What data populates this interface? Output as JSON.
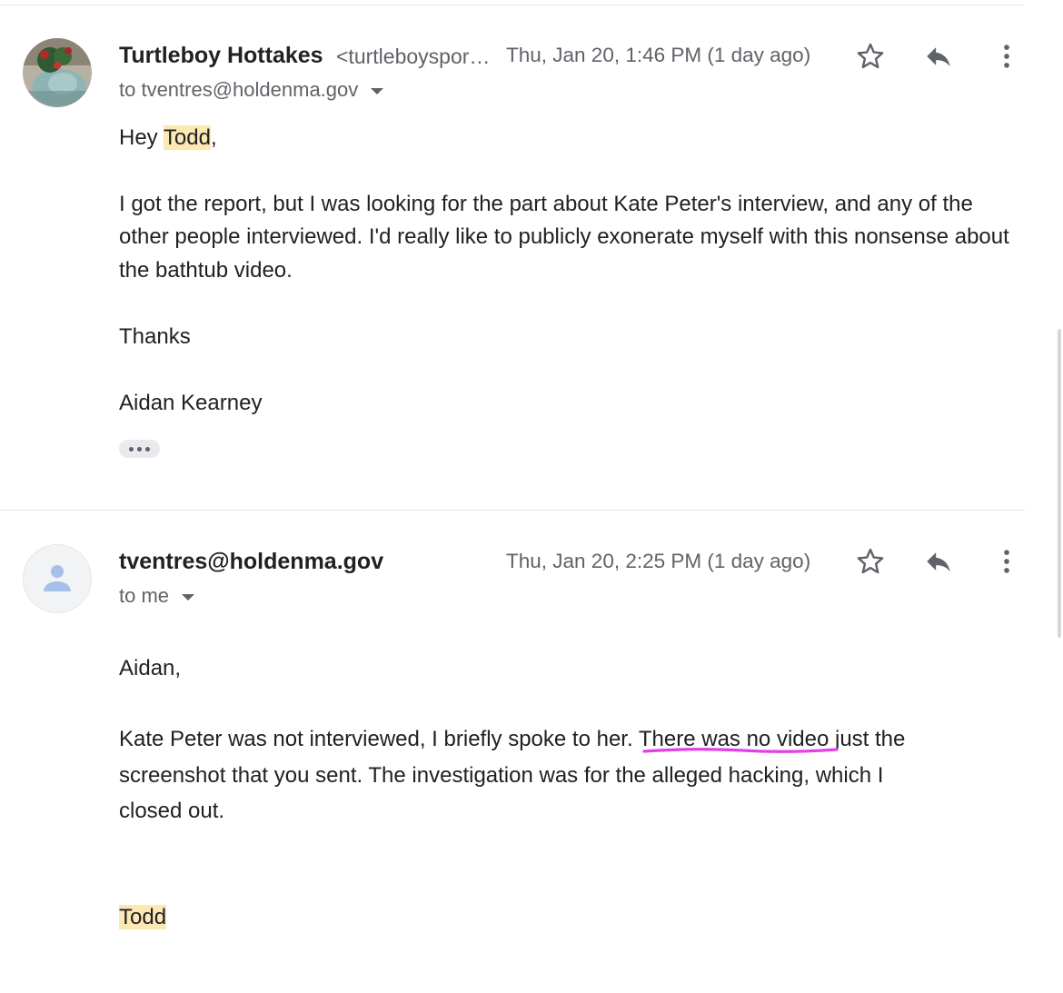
{
  "messages": [
    {
      "sender_name": "Turtleboy Hottakes",
      "sender_email": "<turtleboyspor…",
      "date": "Thu, Jan 20, 1:46 PM (1 day ago)",
      "recipient": "to tventres@holdenma.gov",
      "greeting_prefix": "Hey ",
      "greeting_name": "Todd",
      "greeting_suffix": ",",
      "body_lines": [
        "I got the report, but I was looking for the part about Kate Peter's interview, and any of the",
        "other people interviewed. I'd really like to publicly exonerate myself with this nonsense about",
        "the bathtub video."
      ],
      "thanks": "Thanks",
      "signature": "Aidan Kearney"
    },
    {
      "sender_name": "tventres@holdenma.gov",
      "date": "Thu, Jan 20, 2:25 PM (1 day ago)",
      "recipient": "to me",
      "greeting": "Aidan,",
      "line1_start": "Kate Peter was not interviewed, I briefly spoke to her. ",
      "line1_underlined": "There was no video",
      "line1_end": " just the",
      "line2": "screenshot that you sent. The investigation was for the alleged hacking, which I",
      "line3": "closed out.",
      "signature": "Todd"
    }
  ],
  "colors": {
    "highlight": "#fce8b2",
    "underline_marker": "#e040e6",
    "icon_gray": "#5f6368"
  },
  "icons": [
    "star-icon",
    "reply-icon",
    "more-vert-icon",
    "person-icon",
    "expand-caret-icon",
    "trimmed-content-icon"
  ]
}
